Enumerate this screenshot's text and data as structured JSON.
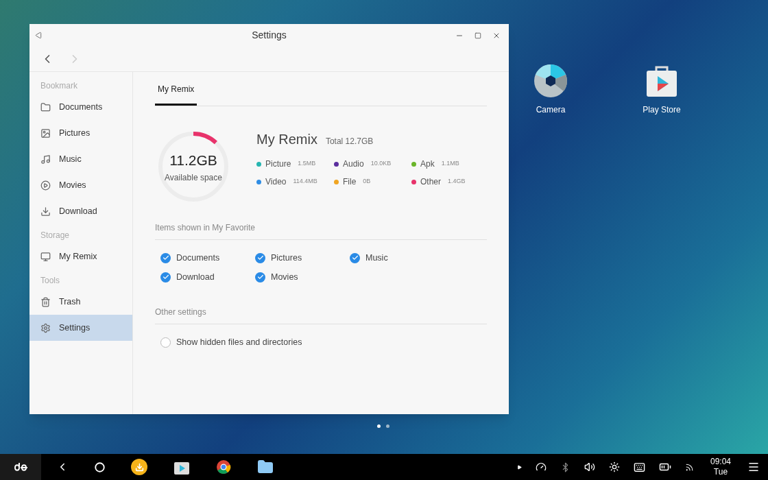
{
  "window": {
    "title": "Settings"
  },
  "sidebar": {
    "sections": [
      {
        "title": "Bookmark",
        "items": [
          {
            "label": "Documents",
            "selected": false
          },
          {
            "label": "Pictures",
            "selected": false
          },
          {
            "label": "Music",
            "selected": false
          },
          {
            "label": "Movies",
            "selected": false
          },
          {
            "label": "Download",
            "selected": false
          }
        ]
      },
      {
        "title": "Storage",
        "items": [
          {
            "label": "My Remix",
            "selected": false
          }
        ]
      },
      {
        "title": "Tools",
        "items": [
          {
            "label": "Trash",
            "selected": false
          },
          {
            "label": "Settings",
            "selected": true
          }
        ]
      }
    ]
  },
  "tabs": [
    {
      "label": "My Remix",
      "selected": true
    }
  ],
  "storage": {
    "free": "11.2GB",
    "free_label": "Available space",
    "level": 0.12,
    "name": "My Remix",
    "total": "Total 12.7GB",
    "legend": [
      {
        "label": "Picture",
        "size": "1.5MB",
        "color": "#26b5b0"
      },
      {
        "label": "Audio",
        "size": "10.0KB",
        "color": "#5b2e9e"
      },
      {
        "label": "Apk",
        "size": "1.1MB",
        "color": "#6ab52a"
      },
      {
        "label": "Video",
        "size": "114.4MB",
        "color": "#2f8de4"
      },
      {
        "label": "File",
        "size": "0B",
        "color": "#f0a522"
      },
      {
        "label": "Other",
        "size": "1.4GB",
        "color": "#e8336b"
      }
    ]
  },
  "favorites": {
    "title": "Items shown in My Favorite",
    "items": [
      {
        "label": "Documents",
        "checked": true
      },
      {
        "label": "Pictures",
        "checked": true
      },
      {
        "label": "Music",
        "checked": true
      },
      {
        "label": "Download",
        "checked": true
      },
      {
        "label": "Movies",
        "checked": true
      }
    ]
  },
  "other_settings": {
    "title": "Other settings",
    "items": [
      {
        "label": "Show hidden files and directories",
        "checked": false
      }
    ]
  },
  "desktop": {
    "icons": [
      {
        "label": "Camera",
        "kind": "camera"
      },
      {
        "label": "Play Store",
        "kind": "store"
      }
    ],
    "pages": [
      {
        "selected": true
      },
      {
        "selected": false
      }
    ]
  },
  "taskbar": {
    "time": "09:04",
    "day": "Tue"
  }
}
